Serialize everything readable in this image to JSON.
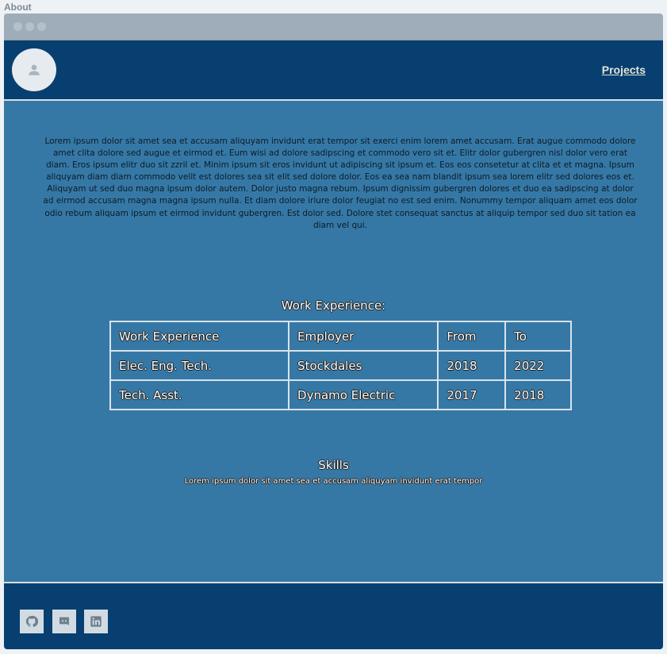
{
  "page": {
    "label": "About"
  },
  "nav": {
    "projects_label": "Projects"
  },
  "intro": {
    "text": "Lorem ipsum dolor sit amet sea et accusam aliquyam invidunt erat tempor sit exerci enim lorem amet accusam. Erat augue commodo dolore amet clita dolore sed augue et eirmod et. Eum wisi ad dolore sadipscing et commodo vero sit et. Elitr dolor gubergren nisl dolor vero erat diam. Eros ipsum elitr duo sit zzril et. Minim ipsum sit eros invidunt ut adipiscing sit ipsum et. Eos eos consetetur at clita et et magna. Ipsum aliquyam diam diam commodo velit est dolores sea sit elit sed dolore dolor. Eos ea sea nam blandit ipsum sea lorem elitr sed dolores eos et. Aliquyam ut sed duo magna ipsum dolor autem. Dolor justo magna rebum. Ipsum dignissim gubergren dolores et duo ea sadipscing at dolor ad eirmod accusam magna magna ipsum nulla. Et diam dolore iriure dolor feugiat no est sed enim. Nonummy tempor aliquam amet eos dolor odio rebum aliquam ipsum et eirmod invidunt gubergren. Est dolor sed. Dolore stet consequat sanctus at aliquip tempor sed duo sit tation ea diam vel qui."
  },
  "work": {
    "title": "Work Experience:",
    "rows": [
      [
        "Work Experience",
        "Employer",
        "From",
        "To"
      ],
      [
        "Elec. Eng. Tech.",
        "Stockdales",
        "2018",
        "2022"
      ],
      [
        "Tech. Asst.",
        "Dynamo Electric",
        "2017",
        "2018"
      ]
    ]
  },
  "skills": {
    "title": "Skills",
    "text": "Lorem ipsum dolor sit amet sea et accusam aliquyam invidunt erat tempor"
  },
  "footer": {
    "icons": [
      "github-icon",
      "discord-icon",
      "linkedin-icon"
    ]
  },
  "colors": {
    "nav_bg": "#073f70",
    "main_bg": "#3578a6",
    "titlebar_bg": "#9fadba"
  }
}
